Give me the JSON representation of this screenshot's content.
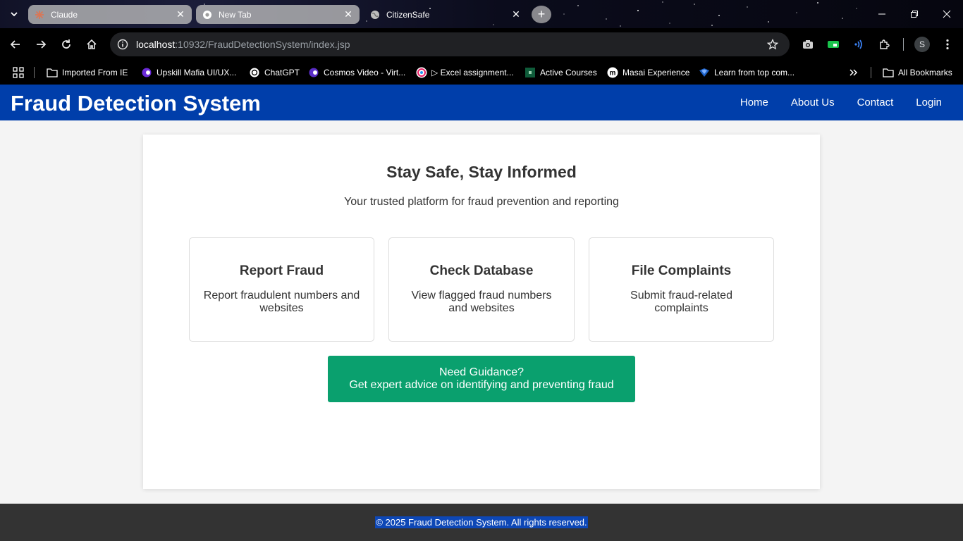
{
  "browser": {
    "tabs": [
      {
        "title": "Claude",
        "icon": "claude-icon",
        "state": "inactive"
      },
      {
        "title": "New Tab",
        "icon": "chrome-icon",
        "state": "inactive"
      },
      {
        "title": "CitizenSafe",
        "icon": "globe-icon",
        "state": "active"
      }
    ],
    "address": {
      "host": "localhost",
      "path": ":10932/FraudDetectionSystem/index.jsp"
    },
    "profile_initial": "S",
    "bookmarks": [
      {
        "label": "Imported From IE",
        "icon": "folder-icon"
      },
      {
        "label": "Upskill Mafia UI/UX...",
        "icon": "upskill-icon"
      },
      {
        "label": "ChatGPT",
        "icon": "chatgpt-icon"
      },
      {
        "label": "Cosmos Video - Virt...",
        "icon": "cosmos-icon"
      },
      {
        "label": "▷ Excel assignment...",
        "icon": "excel-icon"
      },
      {
        "label": "Active Courses",
        "icon": "courses-icon"
      },
      {
        "label": "Masai Experience",
        "icon": "masai-icon"
      },
      {
        "label": "Learn from top com...",
        "icon": "learn-icon"
      }
    ],
    "all_bookmarks_label": "All Bookmarks"
  },
  "site": {
    "title": "Fraud Detection System",
    "nav": [
      "Home",
      "About Us",
      "Contact",
      "Login"
    ],
    "hero": {
      "title": "Stay Safe, Stay Informed",
      "subtitle": "Your trusted platform for fraud prevention and reporting"
    },
    "features": [
      {
        "title": "Report Fraud",
        "desc": "Report fraudulent numbers and websites"
      },
      {
        "title": "Check Database",
        "desc": "View flagged fraud numbers and websites"
      },
      {
        "title": "File Complaints",
        "desc": "Submit fraud-related complaints"
      }
    ],
    "guidance": {
      "line1": "Need Guidance?",
      "line2": "Get expert advice on identifying and preventing fraud"
    },
    "footer": "© 2025 Fraud Detection System. All rights reserved."
  },
  "colors": {
    "header": "#003eaa",
    "guidance_button": "#0aa06e",
    "footer": "#333333"
  }
}
